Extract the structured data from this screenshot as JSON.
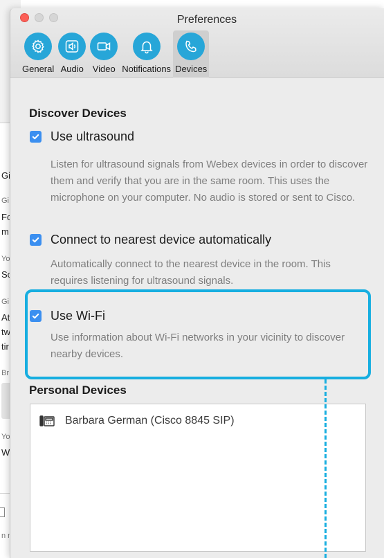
{
  "background_app": {
    "fragments": [
      "Gi",
      "Gi",
      "Fo",
      "m",
      "Yo",
      "Sc",
      "Gi",
      "At",
      "tw",
      "tir",
      "Br",
      "Yo",
      "W",
      "n n"
    ]
  },
  "window": {
    "title": "Preferences"
  },
  "tabs": [
    {
      "label": "General",
      "icon": "gear-icon"
    },
    {
      "label": "Audio",
      "icon": "speaker-icon"
    },
    {
      "label": "Video",
      "icon": "video-camera-icon"
    },
    {
      "label": "Notifications",
      "icon": "bell-icon"
    },
    {
      "label": "Devices",
      "icon": "phone-icon",
      "active": true
    }
  ],
  "discover": {
    "heading": "Discover Devices",
    "ultrasound": {
      "label": "Use ultrasound",
      "checked": true,
      "description": "Listen for ultrasound signals from Webex devices in order to discover them and verify that you are in the same room. This uses the microphone on your computer. No audio is stored or sent to Cisco."
    },
    "connect": {
      "label": "Connect to nearest device automatically",
      "checked": true,
      "description": "Automatically connect to the nearest device in the room. This requires listening for ultrasound signals."
    },
    "wifi": {
      "label": "Use Wi-Fi",
      "checked": true,
      "description": "Use information about Wi-Fi networks in your vicinity to discover nearby devices."
    }
  },
  "personal": {
    "heading": "Personal Devices",
    "devices": [
      {
        "name": "Barbara German (Cisco 8845 SIP)",
        "icon": "desk-phone-icon"
      }
    ]
  },
  "colors": {
    "accent": "#27a6d8",
    "checkbox": "#3b8ff0",
    "highlight": "#17aee0",
    "close_button": "#fc5f57"
  }
}
